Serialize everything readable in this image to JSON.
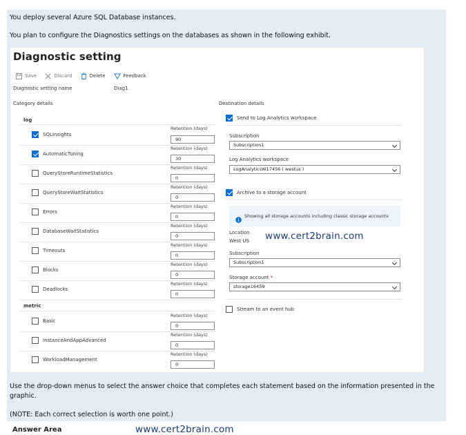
{
  "intro": {
    "line1": "You deploy several Azure SQL Database instances.",
    "line2": "You plan to configure the Diagnostics settings on the databases as shown in the following exhibit."
  },
  "panel": {
    "title": "Diagnostic setting",
    "more": "···",
    "toolbar": {
      "save": "Save",
      "discard": "Discard",
      "delete": "Delete",
      "feedback": "Feedback"
    },
    "setting_name_label": "Diagnostic setting name",
    "setting_name_value": "Diag1",
    "category_details": "Category details",
    "log_header": "log",
    "metric_header": "metric",
    "retention_label": "Retention (days)",
    "logs": [
      {
        "name": "SQLInsights",
        "checked": true,
        "retention": "90"
      },
      {
        "name": "AutomaticTuning",
        "checked": true,
        "retention": "30"
      },
      {
        "name": "QueryStoreRuntimeStatistics",
        "checked": false,
        "retention": "0"
      },
      {
        "name": "QueryStoreWaitStatistics",
        "checked": false,
        "retention": "0"
      },
      {
        "name": "Errors",
        "checked": false,
        "retention": "0"
      },
      {
        "name": "DatabaseWaitStatistics",
        "checked": false,
        "retention": "0"
      },
      {
        "name": "Timeouts",
        "checked": false,
        "retention": "0"
      },
      {
        "name": "Blocks",
        "checked": false,
        "retention": "0"
      },
      {
        "name": "Deadlocks",
        "checked": false,
        "retention": "0"
      }
    ],
    "metrics": [
      {
        "name": "Basic",
        "checked": false,
        "retention": "0"
      },
      {
        "name": "InstanceAndAppAdvanced",
        "checked": false,
        "retention": "0"
      },
      {
        "name": "WorkloadManagement",
        "checked": false,
        "retention": "0"
      }
    ],
    "destination": {
      "header": "Destination details",
      "send_la": "Send to Log Analytics workspace",
      "send_la_checked": true,
      "subscription_label": "Subscription",
      "subscription_value": "Subscription1",
      "la_workspace_label": "Log Analytics workspace",
      "la_workspace_value": "LogAnalyticsW17456 ( westus )",
      "archive": "Archive to a storage account",
      "archive_checked": true,
      "info": "Showing all storage accounts including classic storage accounts",
      "location_label": "Location",
      "location_value": "West US",
      "subscription2_label": "Subscription",
      "subscription2_value": "Subscription1",
      "storage_label": "Storage account",
      "required_mark": "*",
      "storage_value": "storage16459",
      "event_hub": "Stream to an event hub",
      "event_hub_checked": false
    }
  },
  "watermark": "www.cert2brain.com",
  "instructions": {
    "line1": "Use the drop-down menus to select the answer choice that completes each statement based on the information presented in the",
    "line2": "graphic.",
    "note": "(NOTE: Each correct selection is worth one point.)"
  },
  "answer_area": "Answer Area",
  "colors": {
    "accent": "#0a6fd6",
    "panel_bg": "#e3edf6",
    "watermark": "#1a3b76"
  }
}
